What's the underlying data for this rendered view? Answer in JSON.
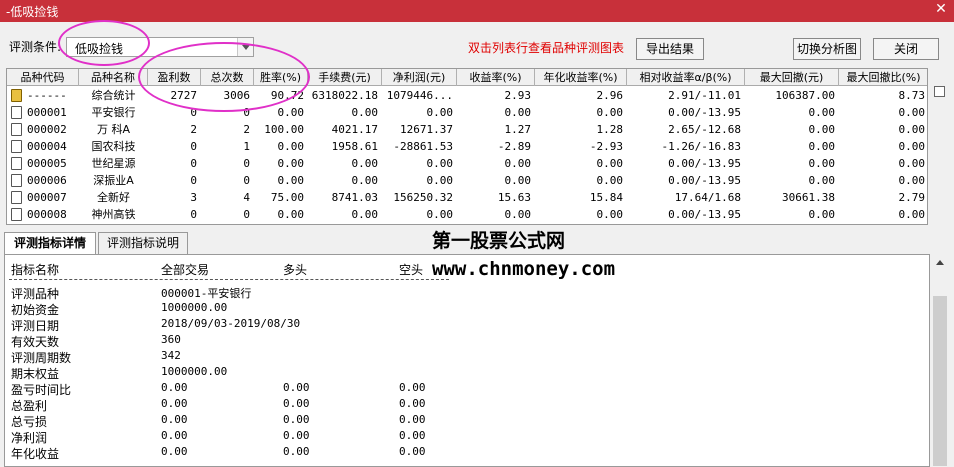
{
  "window": {
    "title": "-低吸捡钱",
    "close_glyph": "✕"
  },
  "toolbar": {
    "condition_label": "评测条件:",
    "condition_value": "低吸捡钱",
    "hint": "双击列表行查看品种评测图表",
    "export_label": "导出结果",
    "switch_chart_label": "切换分析图",
    "close_label": "关闭"
  },
  "grid": {
    "columns": [
      "品种代码",
      "品种名称",
      "盈利数",
      "总次数",
      "胜率(%)",
      "手续费(元)",
      "净利润(元)",
      "收益率(%)",
      "年化收益率(%)",
      "相对收益率α/β(%)",
      "最大回撤(元)",
      "最大回撤比(%)"
    ],
    "rows": [
      {
        "icon": "summary",
        "code": "------",
        "name": "综合统计",
        "wins": "2727",
        "total": "3006",
        "winrate": "90.72",
        "fee": "6318022.18",
        "profit": "1079446...",
        "ret": "2.93",
        "annual": "2.96",
        "relative": "2.91/-11.01",
        "maxdd": "106387.00",
        "maxddratio": "8.73"
      },
      {
        "icon": "doc",
        "code": "000001",
        "name": "平安银行",
        "wins": "0",
        "total": "0",
        "winrate": "0.00",
        "fee": "0.00",
        "profit": "0.00",
        "ret": "0.00",
        "annual": "0.00",
        "relative": "0.00/-13.95",
        "maxdd": "0.00",
        "maxddratio": "0.00"
      },
      {
        "icon": "doc",
        "code": "000002",
        "name": "万 科A",
        "wins": "2",
        "total": "2",
        "winrate": "100.00",
        "fee": "4021.17",
        "profit": "12671.37",
        "ret": "1.27",
        "annual": "1.28",
        "relative": "2.65/-12.68",
        "maxdd": "0.00",
        "maxddratio": "0.00"
      },
      {
        "icon": "doc",
        "code": "000004",
        "name": "国农科技",
        "wins": "0",
        "total": "1",
        "winrate": "0.00",
        "fee": "1958.61",
        "profit": "-28861.53",
        "ret": "-2.89",
        "annual": "-2.93",
        "relative": "-1.26/-16.83",
        "maxdd": "0.00",
        "maxddratio": "0.00"
      },
      {
        "icon": "doc",
        "code": "000005",
        "name": "世纪星源",
        "wins": "0",
        "total": "0",
        "winrate": "0.00",
        "fee": "0.00",
        "profit": "0.00",
        "ret": "0.00",
        "annual": "0.00",
        "relative": "0.00/-13.95",
        "maxdd": "0.00",
        "maxddratio": "0.00"
      },
      {
        "icon": "doc",
        "code": "000006",
        "name": "深振业A",
        "wins": "0",
        "total": "0",
        "winrate": "0.00",
        "fee": "0.00",
        "profit": "0.00",
        "ret": "0.00",
        "annual": "0.00",
        "relative": "0.00/-13.95",
        "maxdd": "0.00",
        "maxddratio": "0.00"
      },
      {
        "icon": "doc",
        "code": "000007",
        "name": "全新好",
        "wins": "3",
        "total": "4",
        "winrate": "75.00",
        "fee": "8741.03",
        "profit": "156250.32",
        "ret": "15.63",
        "annual": "15.84",
        "relative": "17.64/1.68",
        "maxdd": "30661.38",
        "maxddratio": "2.79"
      },
      {
        "icon": "doc",
        "code": "000008",
        "name": "神州高铁",
        "wins": "0",
        "total": "0",
        "winrate": "0.00",
        "fee": "0.00",
        "profit": "0.00",
        "ret": "0.00",
        "annual": "0.00",
        "relative": "0.00/-13.95",
        "maxdd": "0.00",
        "maxddratio": "0.00"
      }
    ]
  },
  "tabs": [
    {
      "label": "评测指标详情",
      "active": true
    },
    {
      "label": "评测指标说明",
      "active": false
    }
  ],
  "detail": {
    "headers": [
      "指标名称",
      "全部交易",
      "多头",
      "空头"
    ],
    "lines": [
      {
        "name": "评测品种",
        "all": "000001-平安银行",
        "long": "",
        "short": ""
      },
      {
        "name": "初始资金",
        "all": "1000000.00",
        "long": "",
        "short": ""
      },
      {
        "name": "评测日期",
        "all": "2018/09/03-2019/08/30",
        "long": "",
        "short": ""
      },
      {
        "name": "有效天数",
        "all": "360",
        "long": "",
        "short": ""
      },
      {
        "name": "评测周期数",
        "all": "342",
        "long": "",
        "short": ""
      },
      {
        "name": "期末权益",
        "all": "1000000.00",
        "long": "",
        "short": ""
      },
      {
        "name": "盈亏时间比",
        "all": "0.00",
        "long": "0.00",
        "short": "0.00"
      },
      {
        "name": "总盈利",
        "all": "0.00",
        "long": "0.00",
        "short": "0.00"
      },
      {
        "name": "总亏损",
        "all": "0.00",
        "long": "0.00",
        "short": "0.00"
      },
      {
        "name": "净利润",
        "all": "0.00",
        "long": "0.00",
        "short": "0.00"
      },
      {
        "name": "年化收益",
        "all": "0.00",
        "long": "0.00",
        "short": "0.00"
      }
    ]
  },
  "watermark": {
    "line1": "第一股票公式网",
    "line2": "www.chnmoney.com"
  },
  "colors": {
    "title_bar": "#c8303a",
    "hint_text": "#e00000",
    "annotation": "#e030c8"
  }
}
